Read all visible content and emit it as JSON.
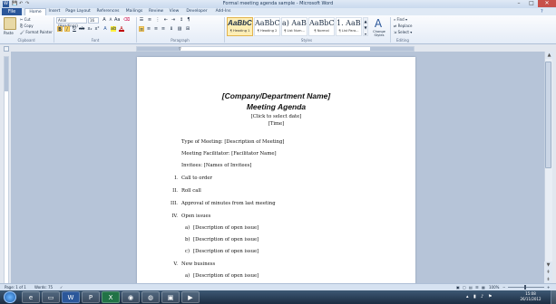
{
  "window": {
    "title": "Formal meeting agenda sample - Microsoft Word",
    "min": "–",
    "max": "□",
    "close": "✕"
  },
  "tabs": [
    "File",
    "Home",
    "Insert",
    "Page Layout",
    "References",
    "Mailings",
    "Review",
    "View",
    "Developer",
    "Add-Ins"
  ],
  "clipboard": {
    "paste": "Paste",
    "cut": "Cut",
    "copy": "Copy",
    "format_painter": "Format Painter",
    "label": "Clipboard"
  },
  "font": {
    "name": "Arial (Headings)",
    "size": "16",
    "label": "Font"
  },
  "paragraph": {
    "label": "Paragraph"
  },
  "styles": {
    "label": "Styles",
    "items": [
      {
        "preview": "AaBbC",
        "name": "¶ Heading 1"
      },
      {
        "preview": "AaBbCcI",
        "name": "¶ Heading 2"
      },
      {
        "preview": "a) AaBb(",
        "name": "¶ List Num..."
      },
      {
        "preview": "AaBbCcI",
        "name": "¶ Normal"
      },
      {
        "preview": "1. AaBb(",
        "name": "¶ List Para..."
      },
      {
        "preview": "AaBbC",
        "name": ""
      }
    ],
    "change_styles": "Change Styles"
  },
  "editing": {
    "find": "Find",
    "replace": "Replace",
    "select": "Select",
    "label": "Editing"
  },
  "document": {
    "company": "[Company/Department Name]",
    "heading": "Meeting Agenda",
    "date": "[Click to select date]",
    "time": "[Time]",
    "type_of_meeting": "Type of Meeting: [Description of Meeting]",
    "facilitator": "Meeting Facilitator: [Facilitator Name]",
    "invitees": "Invitees: [Names of Invitees]",
    "agenda": [
      {
        "num": "I.",
        "text": "Call to order"
      },
      {
        "num": "II.",
        "text": "Roll call"
      },
      {
        "num": "III.",
        "text": "Approval of minutes from last meeting"
      },
      {
        "num": "IV.",
        "text": "Open issues"
      }
    ],
    "open_issues": [
      {
        "num": "a)",
        "text": "[Description of open issue]"
      },
      {
        "num": "b)",
        "text": "[Description of open issue]"
      },
      {
        "num": "c)",
        "text": "[Description of open issue]"
      }
    ],
    "new_business": {
      "num": "V.",
      "text": "New business"
    },
    "new_items": [
      {
        "num": "a)",
        "text": "[Description of open issue]"
      }
    ]
  },
  "status": {
    "page": "Page: 1 of 1",
    "words": "Words: 75",
    "zoom": "100%"
  },
  "taskbar": {
    "time": "15:08",
    "date": "26/11/2012"
  }
}
